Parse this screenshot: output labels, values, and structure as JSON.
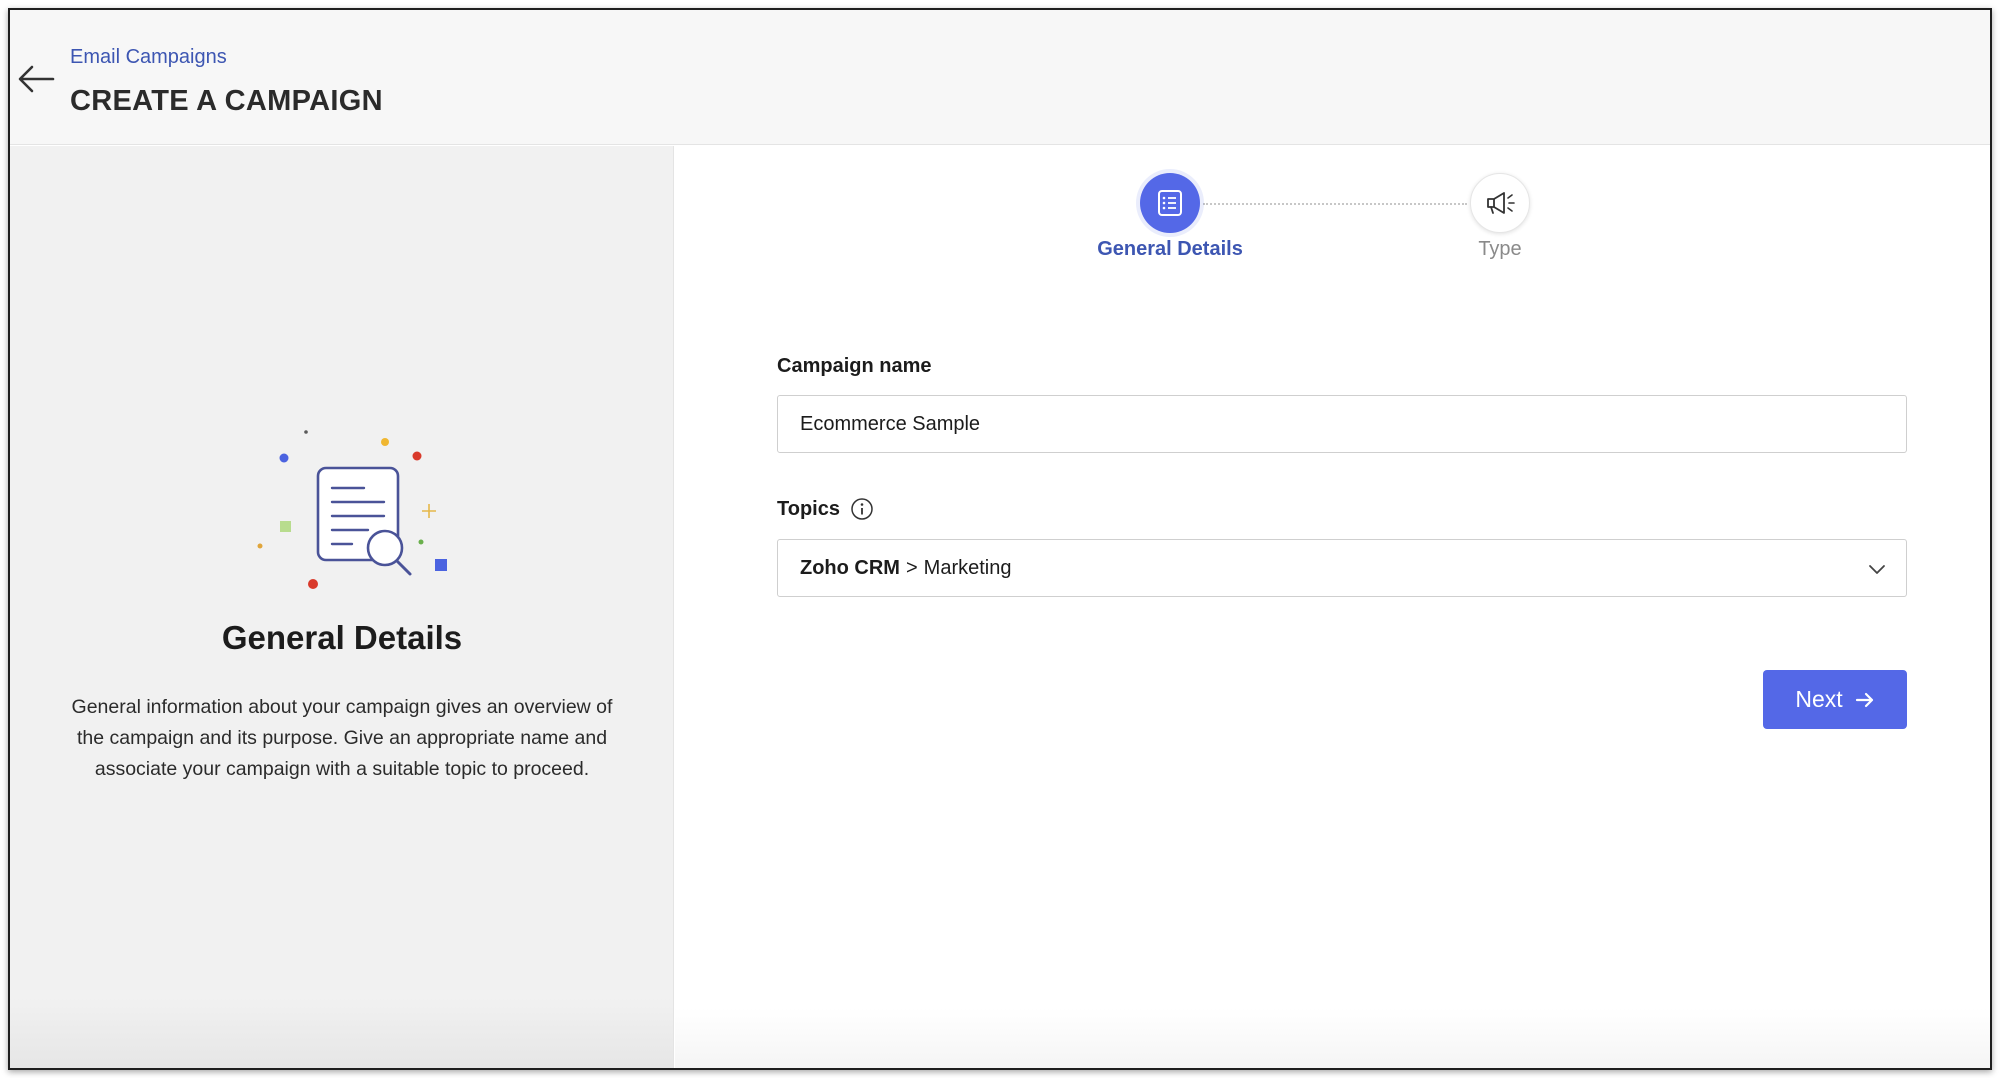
{
  "header": {
    "breadcrumb": "Email Campaigns",
    "title": "CREATE A CAMPAIGN",
    "back_icon": "arrow-left-icon"
  },
  "left_panel": {
    "heading": "General Details",
    "description": "General information about your campaign gives an overview of the campaign and its purpose. Give an appropriate name and associate your campaign with a suitable topic to proceed.",
    "illustration_icon": "document-search-icon"
  },
  "steps": [
    {
      "label": "General Details",
      "icon": "list-document-icon",
      "active": true
    },
    {
      "label": "Type",
      "icon": "megaphone-icon",
      "active": false
    }
  ],
  "form": {
    "campaign_name": {
      "label": "Campaign name",
      "value": "Ecommerce Sample"
    },
    "topics": {
      "label": "Topics",
      "info_icon": "info-icon",
      "selected_parent": "Zoho CRM",
      "separator": ">",
      "selected_child": "Marketing",
      "dropdown_icon": "chevron-down-icon"
    },
    "next_button": {
      "label": "Next",
      "icon": "arrow-right-icon"
    }
  },
  "colors": {
    "accent": "#5468e7",
    "link": "#3d56b2",
    "left_panel_bg": "#f1f1f1",
    "header_bg": "#f7f7f7"
  }
}
